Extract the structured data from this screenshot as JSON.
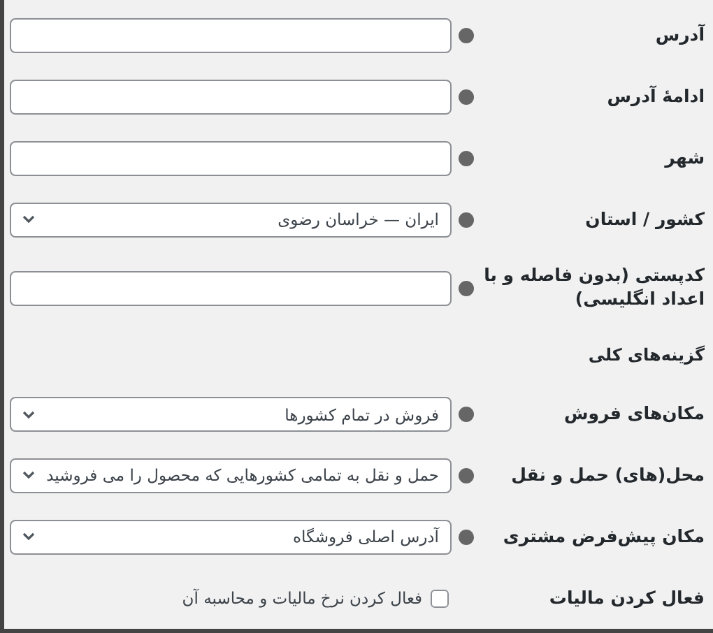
{
  "rows": [
    {
      "kind": "text",
      "label": "آدرس",
      "help": true,
      "value": ""
    },
    {
      "kind": "text",
      "label": "ادامهٔ آدرس",
      "help": true,
      "value": ""
    },
    {
      "kind": "text",
      "label": "شهر",
      "help": true,
      "value": ""
    },
    {
      "kind": "select",
      "label": "کشور / استان",
      "help": true,
      "value": "ایران — خراسان رضوی"
    },
    {
      "kind": "text",
      "label": "کدپستی (بدون فاصله و با اعداد انگلیسی)",
      "help": true,
      "value": ""
    },
    {
      "kind": "heading",
      "label": "گزینه‌های کلی",
      "help": false
    },
    {
      "kind": "select",
      "label": "مکان‌های فروش",
      "help": true,
      "value": "فروش در تمام کشورها"
    },
    {
      "kind": "select",
      "label": "محل(های) حمل و نقل",
      "help": true,
      "value": "حمل و نقل به تمامی کشورهایی که محصول را می فروشید"
    },
    {
      "kind": "select",
      "label": "مکان پیش‌فرض مشتری",
      "help": true,
      "value": "آدرس اصلی فروشگاه"
    },
    {
      "kind": "checkbox",
      "label": "فعال کردن مالیات",
      "help": false,
      "checked": false,
      "text": "فعال کردن نرخ مالیات و محاسبه آن"
    }
  ]
}
